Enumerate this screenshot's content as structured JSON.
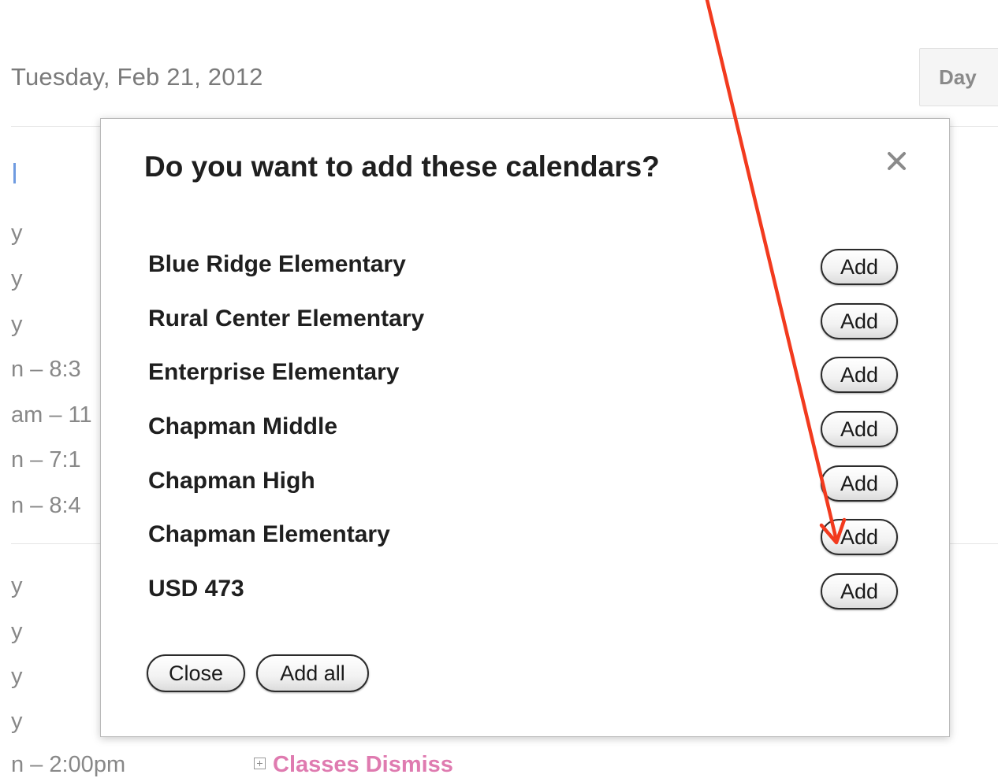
{
  "background": {
    "date_label": "Tuesday, Feb 21, 2012",
    "view_button": "Day",
    "rows": [
      {
        "text": "y"
      },
      {
        "text": "y"
      },
      {
        "text": "y"
      },
      {
        "text": "n – 8:3"
      },
      {
        "text": "am – 11"
      },
      {
        "text": "n – 7:1"
      },
      {
        "text": "n – 8:4"
      },
      {
        "text": "y"
      },
      {
        "text": "y"
      },
      {
        "text": "y"
      },
      {
        "text": "y"
      },
      {
        "text": "n – 2:00pm"
      }
    ],
    "event_label": "Classes Dismiss",
    "event_color": "#df7bb0"
  },
  "dialog": {
    "title": "Do you want to add these calendars?",
    "close_icon": "close-x-icon",
    "calendars": [
      {
        "name": "Blue Ridge Elementary",
        "button": "Add"
      },
      {
        "name": "Rural Center Elementary",
        "button": "Add"
      },
      {
        "name": "Enterprise Elementary",
        "button": "Add"
      },
      {
        "name": "Chapman Middle",
        "button": "Add"
      },
      {
        "name": "Chapman High",
        "button": "Add"
      },
      {
        "name": "Chapman Elementary",
        "button": "Add"
      },
      {
        "name": "USD 473",
        "button": "Add"
      }
    ],
    "close_button": "Close",
    "add_all_button": "Add all"
  },
  "annotation": {
    "arrow_color": "#f23a1e"
  }
}
